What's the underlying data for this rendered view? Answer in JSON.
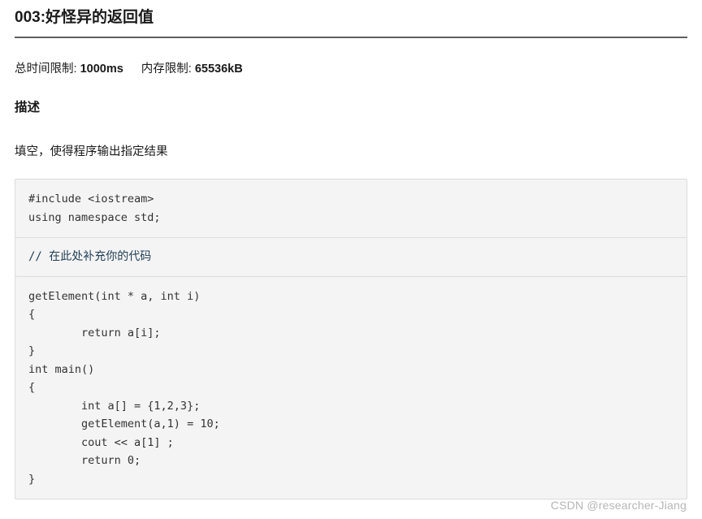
{
  "problem": {
    "title": "003:好怪异的返回值",
    "limits": {
      "time_label": "总时间限制:",
      "time_value": "1000ms",
      "memory_label": "内存限制:",
      "memory_value": "65536kB"
    },
    "description_heading": "描述",
    "description_text": "填空，使得程序输出指定结果",
    "code_blocks": [
      {
        "kind": "code",
        "text": "#include <iostream>\nusing namespace std;"
      },
      {
        "kind": "comment",
        "text": "// 在此处补充你的代码"
      },
      {
        "kind": "code",
        "text": "getElement(int * a, int i)\n{\n        return a[i];\n}\nint main()\n{\n        int a[] = {1,2,3};\n        getElement(a,1) = 10;\n        cout << a[1] ;\n        return 0;\n}"
      }
    ]
  },
  "watermark": {
    "text": "CSDN @researcher-Jiang"
  },
  "colors": {
    "page_background": "#ffffff",
    "text": "#1a1a1a",
    "rule": "#5f5f5f",
    "code_background": "#f4f4f4",
    "code_border": "#dcdcdc",
    "code_text": "#333333",
    "comment_text": "#1f3d55",
    "watermark_text": "#b6b6b6"
  }
}
